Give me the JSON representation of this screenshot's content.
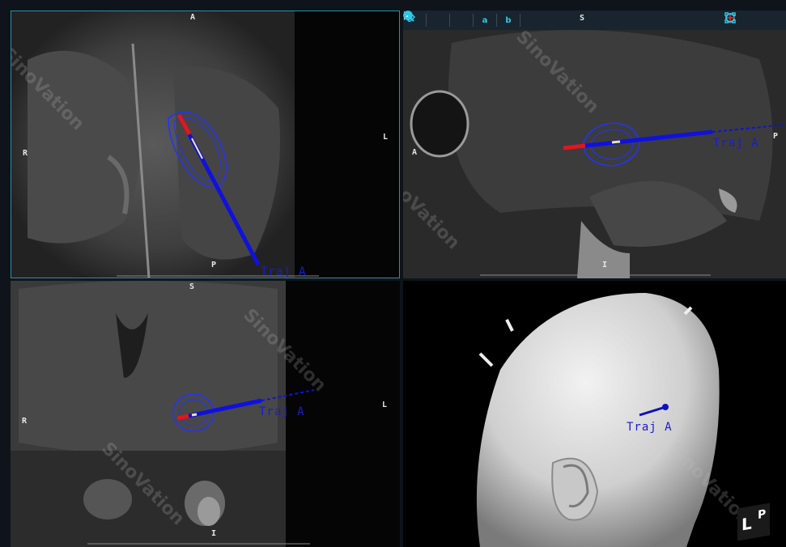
{
  "watermark": "SinoVation",
  "trajectory_label": "Traj A",
  "axial": {
    "top": "A",
    "left": "R",
    "right": "L",
    "bottom": "P"
  },
  "sagittal": {
    "top": "S",
    "left": "A",
    "right": "P",
    "bottom": "I"
  },
  "coronal": {
    "top": "S",
    "left": "R",
    "right": "L",
    "bottom": "I"
  },
  "toolbar": {
    "contrast_a": "a",
    "contrast_b": "b"
  },
  "cube": {
    "face1": "L",
    "face2": "P"
  },
  "colors": {
    "trajectory": "#1010e0",
    "entry": "#e01818",
    "contour": "#2233ff",
    "border_active": "#2a8fa6"
  }
}
